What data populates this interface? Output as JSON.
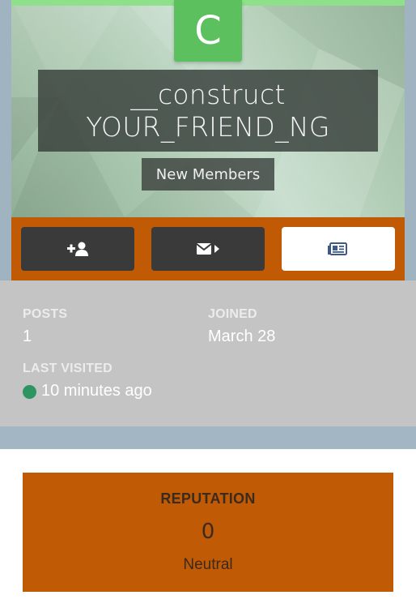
{
  "profile": {
    "avatar_letter": "C",
    "name_line1": "__construct",
    "name_line2": "YOUR_FRIEND_NG",
    "group": "New Members"
  },
  "actions": [
    {
      "icon": "add-user-icon"
    },
    {
      "icon": "message-icon"
    },
    {
      "icon": "activity-feed-icon"
    }
  ],
  "stats": {
    "posts_label": "POSTS",
    "posts_value": "1",
    "joined_label": "JOINED",
    "joined_value": "March 28",
    "last_visited_label": "LAST VISITED",
    "last_visited_value": "10 minutes ago"
  },
  "reputation": {
    "title": "REPUTATION",
    "value": "0",
    "description": "Neutral"
  },
  "colors": {
    "accent_orange": "#c15a05",
    "avatar_green": "#5cc05e",
    "online_green": "#2e9461"
  }
}
